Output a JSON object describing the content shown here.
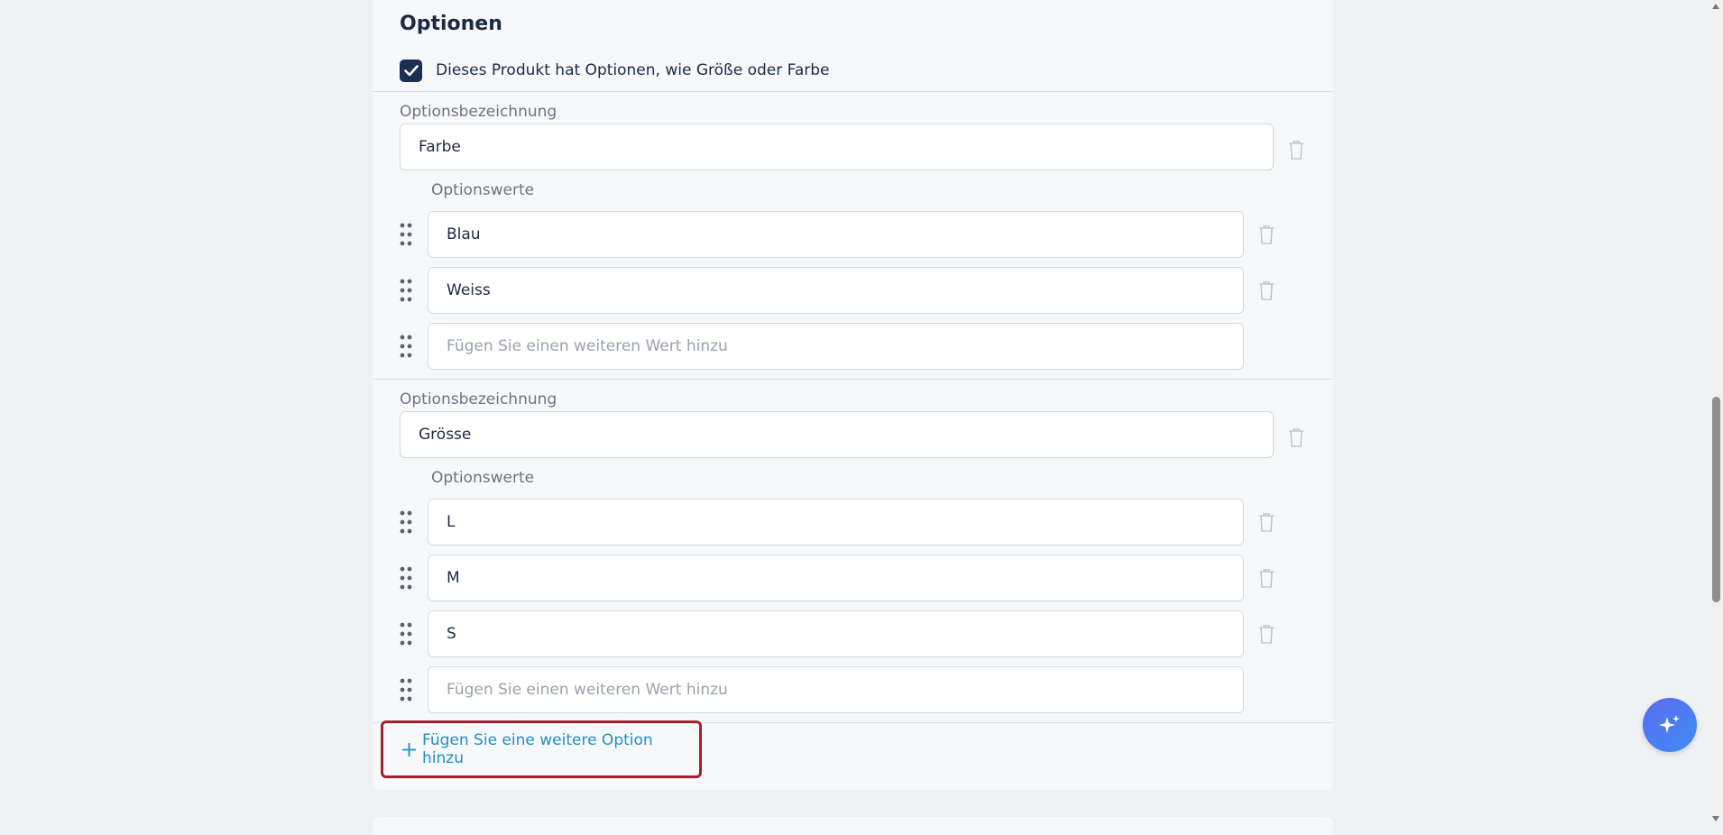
{
  "section": {
    "title": "Optionen",
    "has_options_label": "Dieses Produkt hat Optionen, wie Größe oder Farbe",
    "has_options_checked": true
  },
  "options": [
    {
      "name_label": "Optionsbezeichnung",
      "name_value": "Farbe",
      "values_label": "Optionswerte",
      "values": [
        "Blau",
        "Weiss"
      ],
      "new_value_placeholder": "Fügen Sie einen weiteren Wert hinzu"
    },
    {
      "name_label": "Optionsbezeichnung",
      "name_value": "Grösse",
      "values_label": "Optionswerte",
      "values": [
        "L",
        "M",
        "S"
      ],
      "new_value_placeholder": "Fügen Sie einen weiteren Wert hinzu"
    }
  ],
  "add_option": {
    "plus": "+",
    "label": "Fügen Sie eine weitere Option hinzu"
  },
  "colors": {
    "accent": "#1f8fc6",
    "highlight_border": "#a4202c",
    "checkbox": "#1c2e52"
  },
  "icons": {
    "trash": "trash-icon",
    "grip": "drag-handle-icon",
    "ai": "sparkle-icon"
  }
}
